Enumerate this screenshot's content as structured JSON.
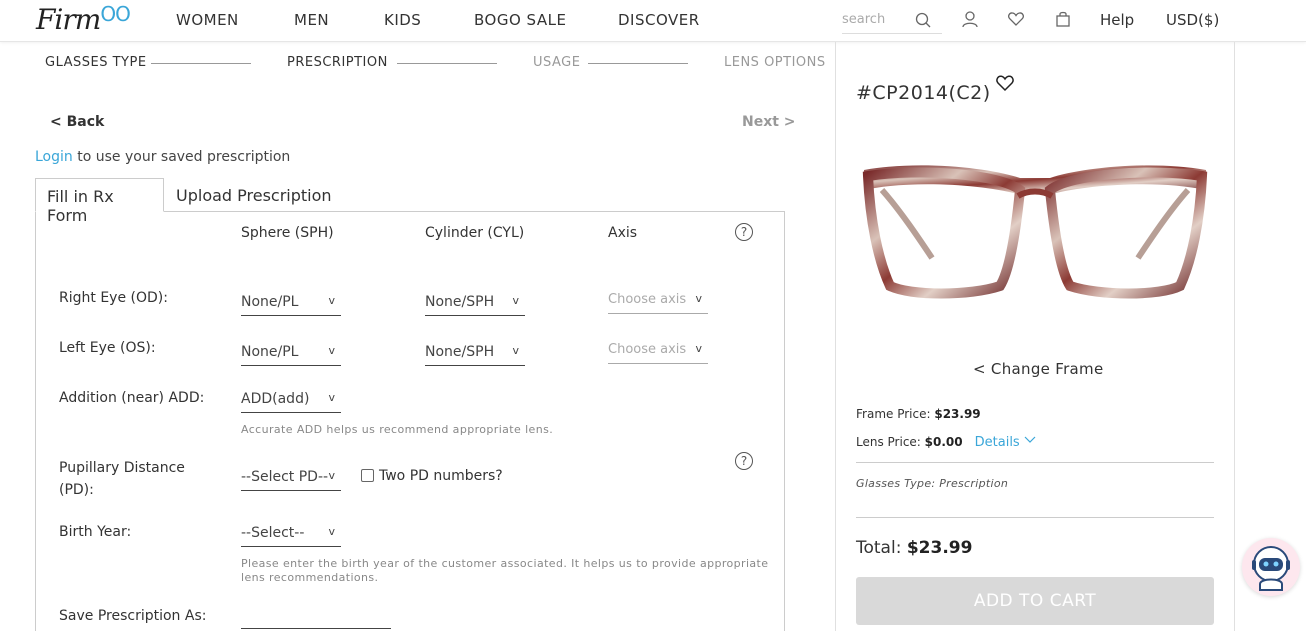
{
  "header": {
    "logo": "Firm",
    "logo_accent": "OO",
    "nav": [
      "WOMEN",
      "MEN",
      "KIDS",
      "BOGO SALE",
      "DISCOVER"
    ],
    "search_placeholder": "search",
    "help": "Help",
    "currency": "USD($)"
  },
  "steps": {
    "glasses_type": "GLASSES TYPE",
    "prescription": "PRESCRIPTION",
    "usage": "USAGE",
    "lens_options": "LENS OPTIONS"
  },
  "nav_buttons": {
    "back": "< Back",
    "next": "Next >"
  },
  "login": {
    "link": "Login",
    "text": " to use your saved prescription"
  },
  "tabs": {
    "fill": "Fill in Rx Form",
    "upload": "Upload Prescription"
  },
  "form": {
    "col_sphere": "Sphere (SPH)",
    "col_cylinder": "Cylinder (CYL)",
    "col_axis": "Axis",
    "help": "?",
    "right_eye": "Right Eye (OD):",
    "left_eye": "Left Eye (OS):",
    "addition": "Addition (near) ADD:",
    "pd_line1": "Pupillary Distance",
    "pd_line2": "(PD):",
    "birth_year": "Birth Year:",
    "save_as": "Save Prescription As:",
    "od_sph": "None/PL",
    "od_cyl": "None/SPH",
    "od_axis": "Choose axis",
    "os_sph": "None/PL",
    "os_cyl": "None/SPH",
    "os_axis": "Choose axis",
    "add_value": "ADD(add)",
    "add_hint": "Accurate ADD helps us recommend appropriate lens.",
    "pd_value": "--Select PD--",
    "two_pd": "Two PD numbers?",
    "birth_value": "--Select--",
    "birth_hint_1": "Please enter the birth year of the customer associated. It helps us to provide appropriate",
    "birth_hint_2": "lens recommendations.",
    "caret": "v"
  },
  "product": {
    "sku": "#CP2014(C2)",
    "change_frame": "< Change Frame",
    "frame_price_label": "Frame Price: ",
    "frame_price": "$23.99",
    "lens_price_label": "Lens Price: ",
    "lens_price": "$0.00",
    "details": "Details",
    "glasses_type": "Glasses Type: Prescription",
    "total_label": "Total: ",
    "total": "$23.99",
    "add_to_cart": "ADD TO CART"
  },
  "colors": {
    "accent": "#3aa6d8",
    "button_disabled": "#d9d9d9"
  }
}
